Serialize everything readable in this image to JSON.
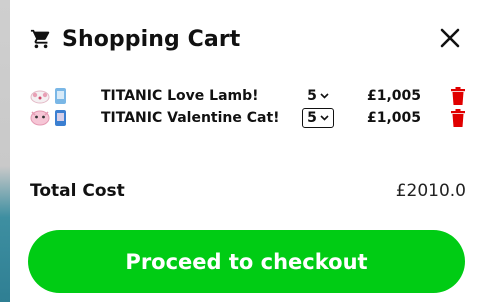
{
  "cart": {
    "title": "Shopping Cart",
    "items": [
      {
        "name": "TITANIC Love Lamb!",
        "quantity": "5",
        "price": "£1,005"
      },
      {
        "name": "TITANIC Valentine Cat!",
        "quantity": "5",
        "price": "£1,005"
      }
    ],
    "total_label": "Total Cost",
    "total_value": "£2010.0",
    "checkout_label": "Proceed to checkout"
  },
  "colors": {
    "checkout_button": "#00cc14",
    "trash_icon": "#e00000"
  },
  "icons": {
    "cart": "shopping-cart-icon",
    "close": "close-icon",
    "delete": "trash-icon",
    "dropdown": "chevron-down-icon"
  }
}
